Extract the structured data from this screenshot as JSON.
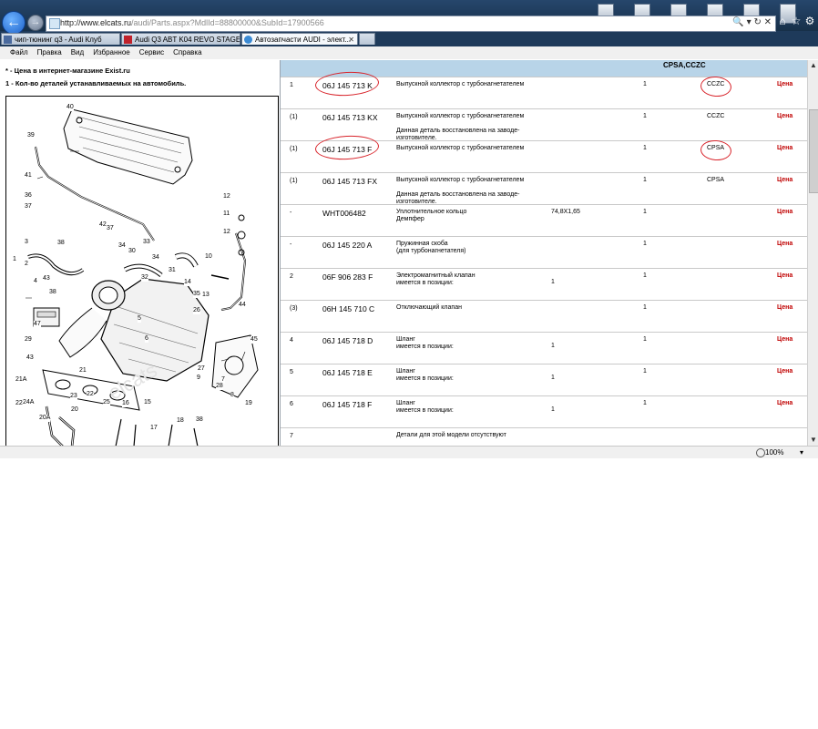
{
  "browser": {
    "address": {
      "host": "http://www.elcats.ru",
      "path": "/audi/Parts.aspx?MdlId=88800000&SubId=17900566"
    },
    "tabs": [
      {
        "label": "чип-тюнинг q3 - Audi Клуб",
        "color": "#4a6a9e"
      },
      {
        "label": "Audi Q3 ABT K04 REVO STAGE III",
        "color": "#c0222b"
      },
      {
        "label": "Автозапчасти AUDI - элект...",
        "color": "#3a8ad4"
      }
    ],
    "menu": [
      "Файл",
      "Правка",
      "Вид",
      "Избранное",
      "Сервис",
      "Справка"
    ],
    "status": {
      "zoom": "100%"
    }
  },
  "left": {
    "note1": "* - Цена в интернет-магазине Exist.ru",
    "note2": "1 - Кол-во деталей устанавливаемых на автомобиль.",
    "diagram_numbers": [
      "40",
      "39",
      "41",
      "36",
      "37",
      "1",
      "2",
      "38",
      "3",
      "43",
      "4",
      "38",
      "47",
      "29",
      "43",
      "21A",
      "22A",
      "20A",
      "24A",
      "23",
      "21",
      "22",
      "20",
      "25",
      "16",
      "15",
      "17",
      "18",
      "38",
      "42",
      "37",
      "34",
      "30",
      "31",
      "33",
      "32",
      "34",
      "35",
      "12",
      "11",
      "12",
      "10",
      "14",
      "13",
      "26",
      "44",
      "45",
      "5",
      "6",
      "9",
      "7",
      "27",
      "28",
      "8",
      "19"
    ]
  },
  "table": {
    "header_engine": "CPSA,CCZC",
    "rows": [
      {
        "pos": "1",
        "part": "06J 145 713 K",
        "desc": [
          "Выпускной коллектор с турбонагнетателем"
        ],
        "qty": "1",
        "engine": "CCZC",
        "price": "Цена",
        "circled": true
      },
      {
        "pos": "(1)",
        "part": "06J 145 713 KX",
        "desc": [
          "Выпускной коллектор с турбонагнетателем",
          "",
          "Данная деталь восстановлена на заводе-",
          "изготовителе."
        ],
        "qty": "1",
        "engine": "CCZC",
        "price": "Цена"
      },
      {
        "pos": "(1)",
        "part": "06J 145 713 F",
        "desc": [
          "Выпускной коллектор с турбонагнетателем"
        ],
        "qty": "1",
        "engine": "CPSA",
        "price": "Цена",
        "circled": true
      },
      {
        "pos": "(1)",
        "part": "06J 145 713 FX",
        "desc": [
          "Выпускной коллектор с турбонагнетателем",
          "",
          "Данная деталь восстановлена на заводе-",
          "изготовителе."
        ],
        "qty": "1",
        "engine": "CPSA",
        "price": "Цена"
      },
      {
        "pos": "-",
        "part": "WHT006482",
        "desc": [
          "Уплотнительное кольцо",
          "Демпфер"
        ],
        "size": "74,8X1,65",
        "qty": "1",
        "engine": "",
        "price": "Цена"
      },
      {
        "pos": "-",
        "part": "06J 145 220 A",
        "desc": [
          "Пружинная скоба",
          "(для турбонагнетателя)"
        ],
        "qty": "1",
        "engine": "",
        "price": "Цена"
      },
      {
        "pos": "2",
        "part": "06F 906 283 F",
        "desc": [
          "Электромагнитный клапан",
          "имеется в позиции:"
        ],
        "inpos": "1",
        "qty": "1",
        "engine": "",
        "price": "Цена"
      },
      {
        "pos": "(3)",
        "part": "06H 145 710 C",
        "desc": [
          "Отключающий клапан"
        ],
        "qty": "1",
        "engine": "",
        "price": "Цена"
      },
      {
        "pos": "4",
        "part": "06J 145 718 D",
        "desc": [
          "Шланг",
          "имеется в позиции:"
        ],
        "inpos": "1",
        "qty": "1",
        "engine": "",
        "price": "Цена"
      },
      {
        "pos": "5",
        "part": "06J 145 718 E",
        "desc": [
          "Шланг",
          "имеется в позиции:"
        ],
        "inpos": "1",
        "qty": "1",
        "engine": "",
        "price": "Цена"
      },
      {
        "pos": "6",
        "part": "06J 145 718 F",
        "desc": [
          "Шланг",
          "имеется в позиции:"
        ],
        "inpos": "1",
        "qty": "1",
        "engine": "",
        "price": "Цена"
      },
      {
        "pos": "7",
        "part": "",
        "desc": [
          "Детали для этой модели отсутствуют"
        ],
        "qty": "",
        "engine": "",
        "price": ""
      }
    ]
  }
}
